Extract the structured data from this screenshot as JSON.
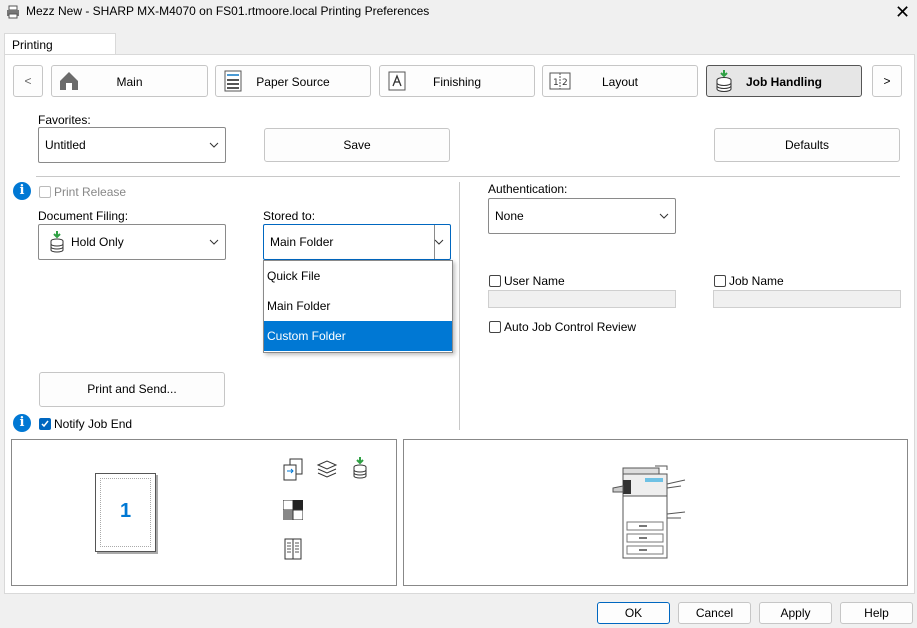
{
  "window": {
    "title": "Mezz New - SHARP MX-M4070 on FS01.rtmoore.local Printing Preferences",
    "close_glyph": "✕"
  },
  "tab": {
    "label": "Printing Preferences"
  },
  "nav": {
    "prev": "<",
    "next": ">",
    "items": [
      {
        "label": "Main",
        "icon": "home-icon"
      },
      {
        "label": "Paper Source",
        "icon": "printer-tray-icon"
      },
      {
        "label": "Finishing",
        "icon": "finishing-icon"
      },
      {
        "label": "Layout",
        "icon": "layout-icon"
      },
      {
        "label": "Job Handling",
        "icon": "job-handling-icon",
        "active": true
      }
    ]
  },
  "favorites": {
    "label": "Favorites:",
    "value": "Untitled",
    "save": "Save",
    "defaults": "Defaults"
  },
  "left": {
    "print_release": "Print Release",
    "document_filing_label": "Document Filing:",
    "document_filing_value": "Hold Only",
    "stored_to_label": "Stored to:",
    "stored_to_value": "Main Folder",
    "stored_to_options": [
      "Quick File",
      "Main Folder",
      "Custom Folder"
    ],
    "highlighted_option": "Custom Folder",
    "print_and_send": "Print and Send...",
    "notify_job_end": "Notify Job End"
  },
  "right": {
    "authentication_label": "Authentication:",
    "authentication_value": "None",
    "user_name": "User Name",
    "job_name": "Job Name",
    "auto_job_control_review": "Auto Job Control Review"
  },
  "preview": {
    "page_number": "1"
  },
  "footer": {
    "ok": "OK",
    "cancel": "Cancel",
    "apply": "Apply",
    "help": "Help"
  },
  "colors": {
    "accent": "#0078d4",
    "highlight": "#0078d4"
  }
}
